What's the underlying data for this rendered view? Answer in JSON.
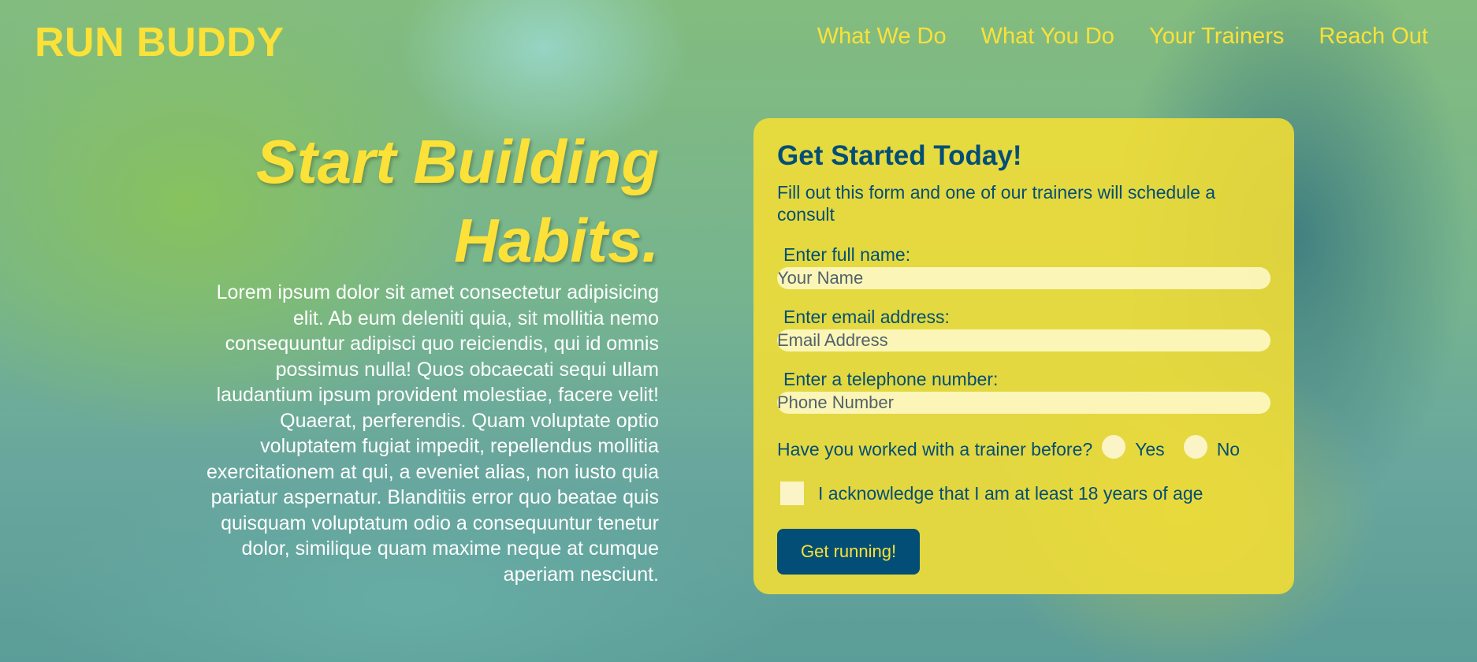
{
  "header": {
    "logo": "RUN BUDDY",
    "nav": [
      "What We Do",
      "What You Do",
      "Your Trainers",
      "Reach Out"
    ]
  },
  "hero": {
    "title_line1": "Start Building",
    "title_line2": "Habits.",
    "body": "Lorem ipsum dolor sit amet consectetur adipisicing elit. Ab eum deleniti quia, sit mollitia nemo consequuntur adipisci quo reiciendis, qui id omnis possimus nulla! Quos obcaecati sequi ullam laudantium ipsum provident molestiae, facere velit! Quaerat, perferendis. Quam voluptate optio voluptatem fugiat impedit, repellendus mollitia exercitationem at qui, a eveniet alias, non iusto quia pariatur aspernatur. Blanditiis error quo beatae quis quisquam voluptatum odio a consequuntur tenetur dolor, similique quam maxime neque at cumque aperiam nesciunt."
  },
  "form": {
    "title": "Get Started Today!",
    "intro": "Fill out this form and one of our trainers will schedule a consult",
    "name": {
      "label": "Enter full name:",
      "placeholder": "Your Name",
      "value": ""
    },
    "email": {
      "label": "Enter email address:",
      "placeholder": "Email Address",
      "value": ""
    },
    "phone": {
      "label": "Enter a telephone number:",
      "placeholder": "Phone Number",
      "value": ""
    },
    "trainer_question": "Have you worked with a trainer before?",
    "yes_label": "Yes",
    "no_label": "No",
    "age_ack": "I acknowledge that I am at least 18 years of age",
    "submit_label": "Get running!"
  },
  "colors": {
    "accent_yellow": "#fce138",
    "brand_blue": "#024e76",
    "card_yellow": "#f4de34"
  }
}
